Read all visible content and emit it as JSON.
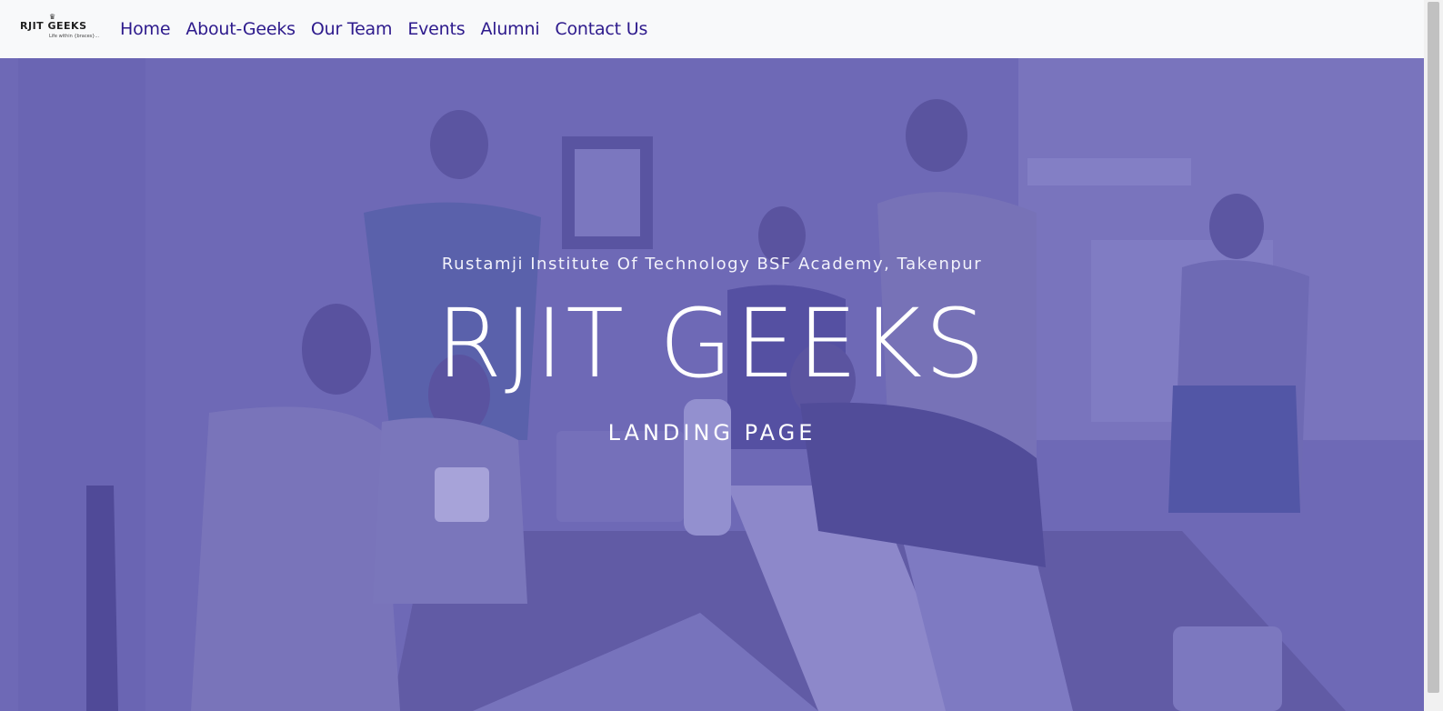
{
  "navbar": {
    "logo": {
      "name": "RJIT GEEKS",
      "tagline": "Life within {braces}..."
    },
    "items": [
      {
        "label": "Home"
      },
      {
        "label": "About-Geeks"
      },
      {
        "label": "Our Team"
      },
      {
        "label": "Events"
      },
      {
        "label": "Alumni"
      },
      {
        "label": "Contact Us"
      }
    ],
    "link_color": "#2d1a8c",
    "background": "#f8f9fa"
  },
  "hero": {
    "subtitle": "Rustamji Institute Of Technology BSF Academy, Takenpur",
    "title": "RJIT GEEKS",
    "tagline": "LANDING PAGE",
    "overlay_color": "#6b66b4",
    "text_color": "#ffffff"
  }
}
